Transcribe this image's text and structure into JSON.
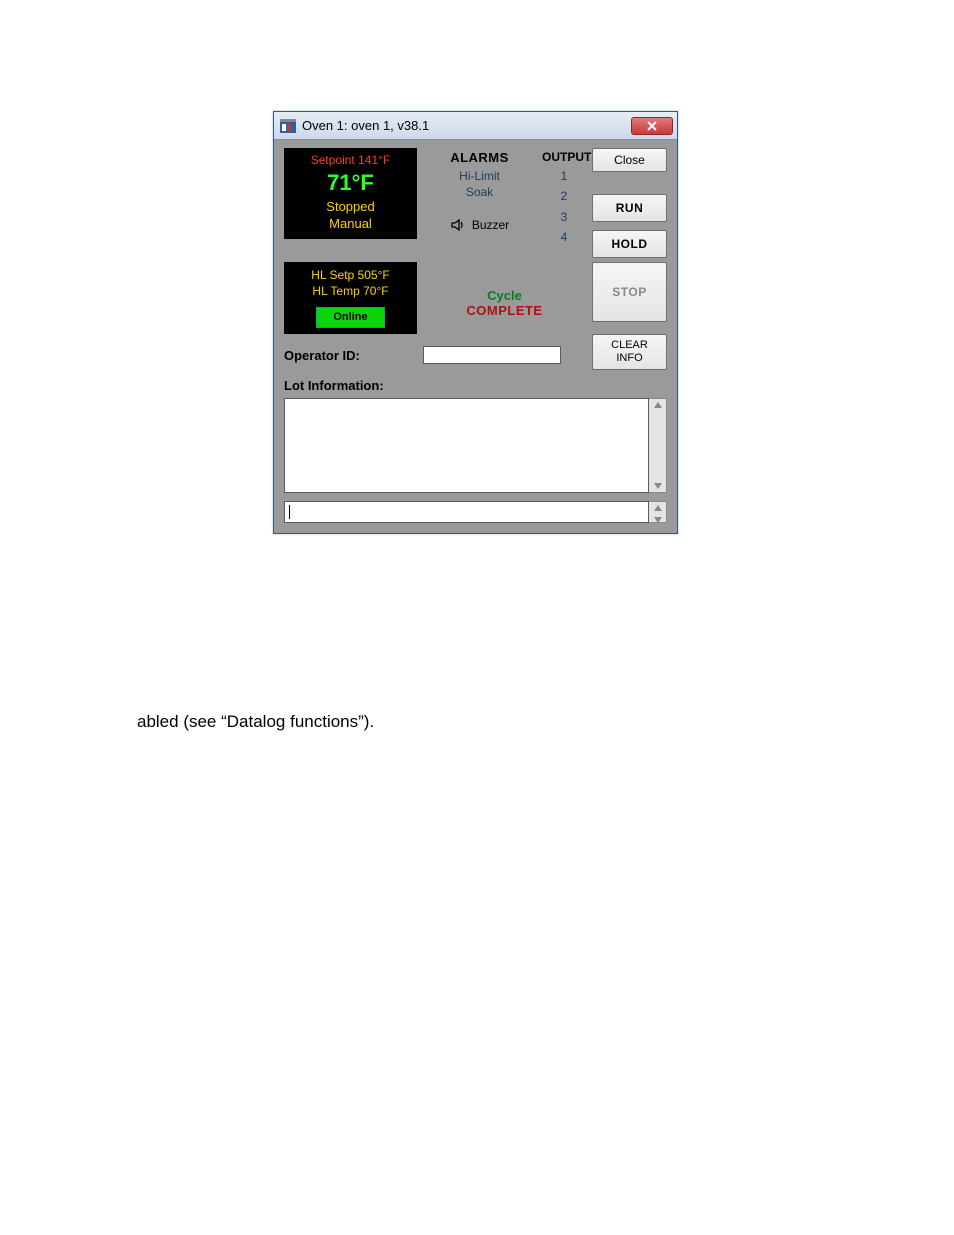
{
  "title": "Oven 1: oven 1, v38.1",
  "left_panel1": {
    "setpoint": "Setpoint 141°F",
    "temperature": "71°F",
    "status": "Stopped",
    "mode": "Manual"
  },
  "alarms": {
    "header": "ALARMS",
    "items": [
      "Hi-Limit",
      "Soak"
    ],
    "buzzer": "Buzzer"
  },
  "outputs": {
    "header": "OUTPUTS",
    "items": [
      "1",
      "2",
      "3",
      "4"
    ]
  },
  "buttons": {
    "close": "Close",
    "run": "RUN",
    "hold": "HOLD",
    "stop": "STOP",
    "clear_info_l1": "CLEAR",
    "clear_info_l2": "INFO"
  },
  "left_panel2": {
    "hl_setp": "HL Setp 505°F",
    "hl_temp": "HL Temp 70°F",
    "online": "Online"
  },
  "cycle": {
    "line1": "Cycle",
    "line2": "COMPLETE"
  },
  "labels": {
    "operator_id": "Operator ID:",
    "lot_info": "Lot Information:"
  },
  "doc_text": "abled (see “Datalog functions”)."
}
